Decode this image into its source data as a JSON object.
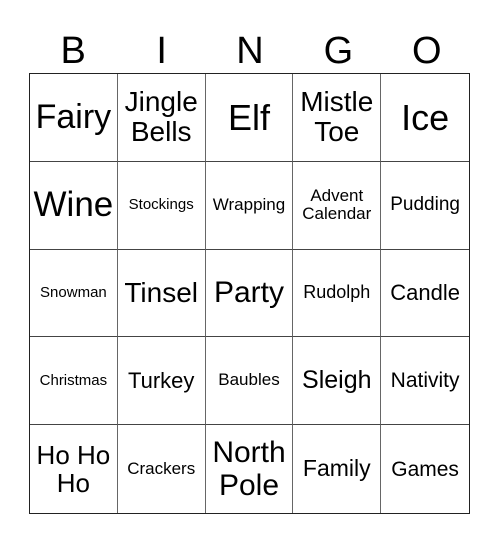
{
  "header": {
    "letters": [
      "B",
      "I",
      "N",
      "G",
      "O"
    ]
  },
  "card": {
    "rows": [
      [
        "Fairy",
        "Jingle Bells",
        "Elf",
        "Mistle Toe",
        "Ice"
      ],
      [
        "Wine",
        "Stockings",
        "Wrapping",
        "Advent Calendar",
        "Pudding"
      ],
      [
        "Snowman",
        "Tinsel",
        "Party",
        "Rudolph",
        "Candle"
      ],
      [
        "Christmas",
        "Turkey",
        "Baubles",
        "Sleigh",
        "Nativity"
      ],
      [
        "Ho Ho Ho",
        "Crackers",
        "North Pole",
        "Family",
        "Games"
      ]
    ]
  }
}
